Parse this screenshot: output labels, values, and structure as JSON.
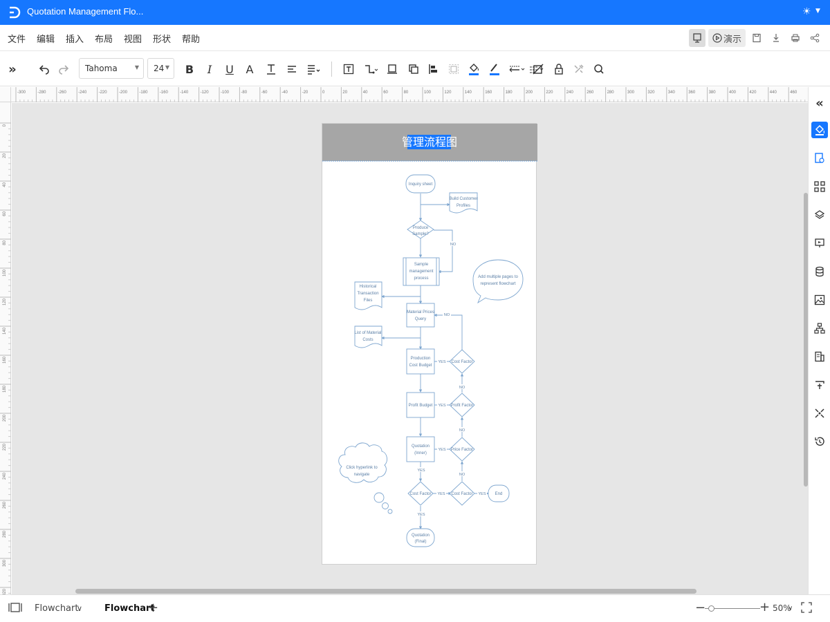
{
  "app": {
    "title": "Quotation Management Flo...",
    "theme_icon": "sun-icon",
    "accent": "#1677ff"
  },
  "menu": {
    "items": [
      "文件",
      "编辑",
      "插入",
      "布局",
      "视图",
      "形状",
      "帮助"
    ],
    "present_label": "演示"
  },
  "toolbar": {
    "font": "Tahoma",
    "font_size": "24",
    "icons": [
      "expand-icon",
      "undo-icon",
      "redo-icon",
      "bold-icon",
      "italic-icon",
      "underline-icon",
      "font-color-icon",
      "text-style-icon",
      "align-icon",
      "line-spacing-icon",
      "text-box-icon",
      "connector-icon",
      "front-icon",
      "back-icon",
      "align-objects-icon",
      "group-icon",
      "fill-icon",
      "line-color-icon",
      "line-style-icon",
      "arrow-style-icon",
      "shadow-icon",
      "lock-icon",
      "tools-icon",
      "search-icon"
    ]
  },
  "rulers": {
    "horizontal": [
      "-300",
      "-280",
      "-260",
      "-240",
      "-220",
      "-200",
      "-180",
      "-160",
      "-140",
      "-120",
      "-100",
      "-80",
      "-60",
      "-40",
      "-20",
      "0",
      "20",
      "40",
      "60",
      "80",
      "100",
      "120",
      "140",
      "160",
      "180",
      "200",
      "220",
      "240",
      "260",
      "280",
      "300",
      "320",
      "340",
      "360",
      "380",
      "400",
      "420",
      "440",
      "460"
    ],
    "vertical": [
      "0",
      "20",
      "40",
      "60",
      "80",
      "100",
      "120",
      "140",
      "160",
      "180",
      "200",
      "220",
      "240",
      "260",
      "280",
      "300",
      "320"
    ]
  },
  "diagram": {
    "header": "管理流程图",
    "header_bg": "#a6a6a6",
    "line_color": "#7ea6cf",
    "nodes": {
      "inquiry": "Inquiry sheet",
      "build_profiles_1": "Build Customer",
      "build_profiles_2": "Profiles",
      "produce_sample_1": "Produce",
      "produce_sample_2": "Sample?",
      "sample_mgmt_1": "Sample",
      "sample_mgmt_2": "management",
      "sample_mgmt_3": "process",
      "historical_1": "Historical",
      "historical_2": "Transaction",
      "historical_3": "Files",
      "material_query_1": "Material Prices",
      "material_query_2": "Query",
      "material_list_1": "List of Material",
      "material_list_2": "Costs",
      "production_budget_1": "Production",
      "production_budget_2": "Cost Budget",
      "cost_factor_1": "Cost Factor",
      "profit_budget": "Profit Budget",
      "profit_factor": "Profit Factor",
      "quotation_inner_1": "Quotation",
      "quotation_inner_2": "(Inner)",
      "price_factor": "Price Factor",
      "cost_factor_2": "Cost Factor",
      "cost_factor_3": "Cost Factor",
      "end": "End",
      "quotation_final_1": "Quotation",
      "quotation_final_2": "(Final)",
      "callout_1": "Add multiple pages to",
      "callout_2": "represent flowchart",
      "cloud_1": "Click hyperlink to",
      "cloud_2": "navigate"
    },
    "labels": {
      "no": "NO",
      "yes": "YES"
    }
  },
  "rightbar": {
    "icons": [
      "collapse-icon",
      "fill-icon",
      "page-settings-icon",
      "shapes-icon",
      "layers-icon",
      "presentation-icon",
      "data-icon",
      "image-icon",
      "org-chart-icon",
      "layout-icon",
      "format-icon",
      "connect-icon",
      "history-icon"
    ]
  },
  "status": {
    "page_tab_1": "Flowchart",
    "page_tab_2": "Flowchart",
    "zoom": "50%"
  }
}
